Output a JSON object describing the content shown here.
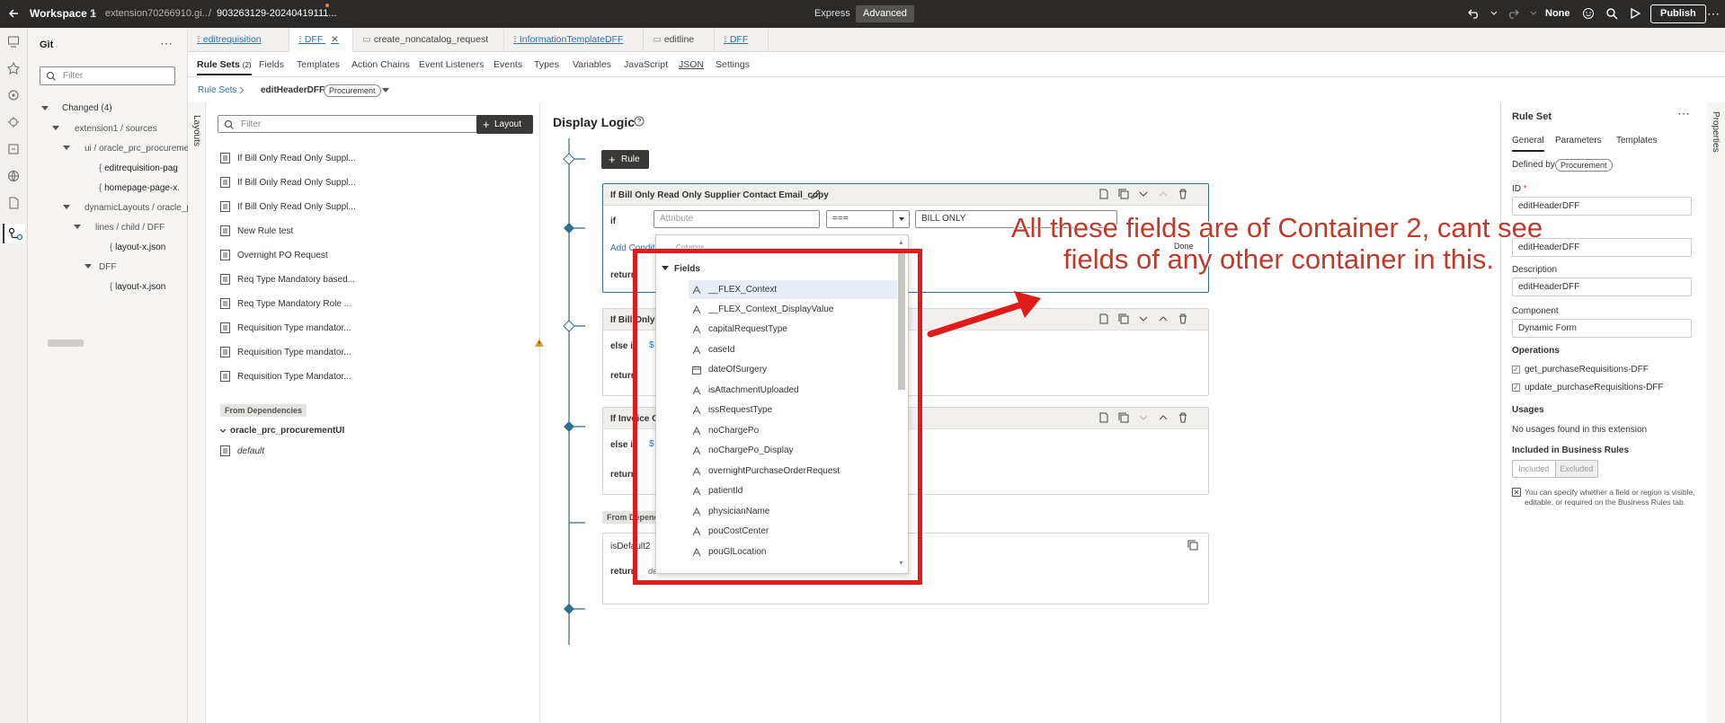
{
  "topbar": {
    "workspace": "Workspace 1",
    "repo": "extension70266910.gi...",
    "sep": "/",
    "branch": "903263129-20240419111...",
    "mode_express": "Express",
    "mode_advanced": "Advanced",
    "none_label": "None",
    "publish": "Publish"
  },
  "git": {
    "title": "Git",
    "filter_placeholder": "Filter",
    "changed": "Changed (4)",
    "items": [
      "extension1 / sources",
      "ui / oracle_prc_procuremen",
      "editrequisition-pag",
      "homepage-page-x.",
      "dynamicLayouts / oracle_p",
      "lines / child / DFF",
      "layout-x.json",
      "DFF",
      "layout-x.json"
    ]
  },
  "tabs": [
    "editrequisition",
    "DFF",
    "create_noncatalog_request",
    "InformationTemplateDFF",
    "editline",
    "DFF"
  ],
  "subnav": {
    "items": [
      "Rule Sets",
      "Fields",
      "Templates",
      "Action Chains",
      "Event Listeners",
      "Events",
      "Types",
      "Variables",
      "JavaScript",
      "JSON",
      "Settings"
    ],
    "rule_sets_count": "(2)"
  },
  "crumb": {
    "root": "Rule Sets",
    "current": "editHeaderDFF",
    "badge": "Procurement"
  },
  "rulelist": {
    "side_label": "Layouts",
    "filter_placeholder": "Filter",
    "layout_button": "Layout",
    "items": [
      "If Bill Only Read Only Suppl...",
      "If Bill Only Read Only Suppl...",
      "If Bill Only Read Only Suppl...",
      "New Rule test",
      "Overnight PO Request",
      "Req Type Mandatory based...",
      "Req Type Mandatory Role ...",
      "Requisition Type mandator...",
      "Requisition Type mandator...",
      "Requisition Type Mandator..."
    ],
    "from_dependencies": "From Dependencies",
    "dep_group": "oracle_prc_procurementUI",
    "dep_default": "default"
  },
  "canvas": {
    "title": "Display Logic",
    "rule_button": "Rule",
    "card1_title": "If Bill Only Read Only Supplier Contact Email_copy",
    "if_label": "if",
    "attribute_placeholder": "Attribute",
    "operator": "===",
    "value": "BILL ONLY",
    "add_condition": "Add Conditi",
    "done": "Done",
    "return_label": "return",
    "card2_title": "If Bill Only",
    "else_if": "else if",
    "dollar": "$",
    "card3_title": "If Invoice O",
    "from_dep": "From Depend",
    "card4_title": "isDefault2",
    "default_text": "default"
  },
  "dropdown": {
    "partial_top": "Columns",
    "group": "Fields",
    "items": [
      "__FLEX_Context",
      "__FLEX_Context_DisplayValue",
      "capitalRequestType",
      "caseId",
      "dateOfSurgery",
      "isAttachmentUploaded",
      "issRequestType",
      "noChargePo",
      "noChargePo_Display",
      "overnightPurchaseOrderRequest",
      "patientId",
      "physicianName",
      "pouCostCenter",
      "pouGlLocation"
    ]
  },
  "props": {
    "title": "Rule Set",
    "tabs": [
      "General",
      "Parameters",
      "Templates"
    ],
    "defined_by": "Defined by",
    "defined_badge": "Procurement",
    "id_label": "ID",
    "id_value": "editHeaderDFF",
    "label_value": "editHeaderDFF",
    "description_label": "Description",
    "description_value": "editHeaderDFF",
    "component_label": "Component",
    "component_value": "Dynamic Form",
    "operations_label": "Operations",
    "op1": "get_purchaseRequisitions-DFF",
    "op2": "update_purchaseRequisitions-DFF",
    "usages_label": "Usages",
    "usages_text": "No usages found in this extension",
    "included_label": "Included in Business Rules",
    "included": "Included",
    "excluded": "Excluded",
    "hint1": "You can specify whether a field or region is visible,",
    "hint2": "editable, or required on the Business Rules tab.",
    "vertical": "Properties"
  },
  "annotation": {
    "line1": "All these fields are of Container 2, cant see",
    "line2": "fields of any other container in this."
  },
  "colors": {
    "annotation": "#e11a1a",
    "topbar": "#2b2a28",
    "link": "#2a6ebb"
  }
}
